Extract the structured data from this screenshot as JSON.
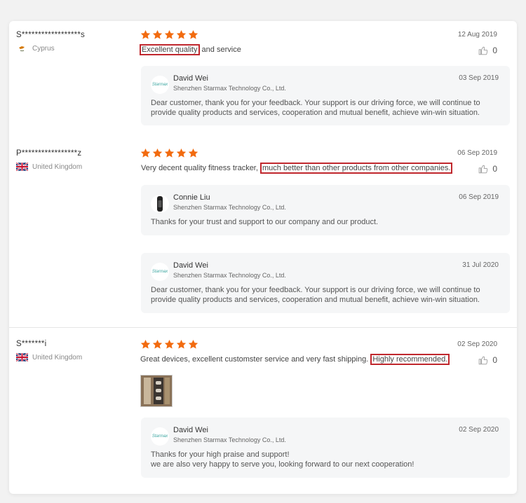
{
  "reviews": [
    {
      "user": "S******************s",
      "country": "Cyprus",
      "date": "12 Aug 2019",
      "likes": "0",
      "text_highlight": "Excellent quality",
      "text_after": " and service",
      "replies": [
        {
          "logo": "Starmax",
          "name": "David Wei",
          "company": "Shenzhen Starmax Technology Co., Ltd.",
          "date": "03 Sep 2019",
          "body": "Dear customer, thank you for your feedback. Your support is our driving force, we will continue to provide quality products and services, cooperation and mutual benefit, achieve win-win situation."
        }
      ]
    },
    {
      "user": "P*****************z",
      "country": "United Kingdom",
      "date": "06 Sep 2019",
      "likes": "0",
      "text_before": "Very decent quality fitness tracker, ",
      "text_highlight": "much better than other products from other companies.",
      "replies": [
        {
          "name": "Connie Liu",
          "company": "Shenzhen Starmax Technology Co., Ltd.",
          "date": "06 Sep 2019",
          "body": "Thanks for your trust and support to our company and our product."
        },
        {
          "logo": "Starmax",
          "name": "David Wei",
          "company": "Shenzhen Starmax Technology Co., Ltd.",
          "date": "31 Jul 2020",
          "body": "Dear customer, thank you for your feedback. Your support is our driving force, we will continue to provide quality products and services, cooperation and mutual benefit, achieve win-win situation."
        }
      ]
    },
    {
      "user": "S*******i",
      "country": "United Kingdom",
      "date": "02 Sep 2020",
      "likes": "0",
      "text_before": "Great devices, excellent customster service and very fast shipping. ",
      "text_highlight": "Highly recommended.",
      "replies": [
        {
          "logo": "Starmax",
          "name": "David Wei",
          "company": "Shenzhen Starmax Technology Co., Ltd.",
          "date": "02 Sep 2020",
          "body_line1": "Thanks for your high praise and support!",
          "body_line2": "we are also very happy to serve you, looking forward to our next cooperation!"
        }
      ]
    }
  ],
  "colors": {
    "star": "#f26b0f",
    "highlight_border": "#c0272d"
  },
  "icons": {
    "rating": "star-icon",
    "like": "thumbs-up-icon"
  }
}
